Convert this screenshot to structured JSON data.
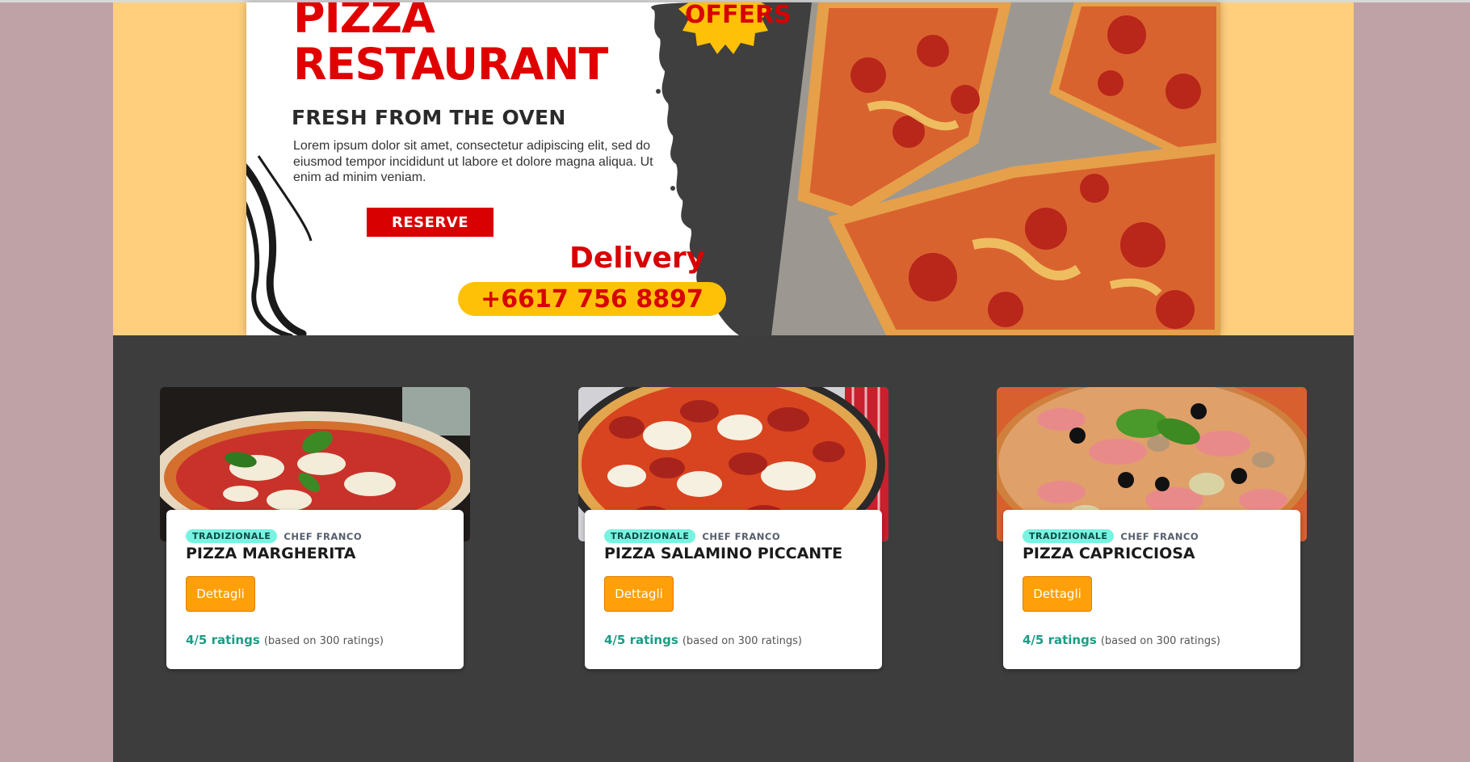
{
  "banner": {
    "title_line1": "PIZZA",
    "title_line2": "RESTAURANT",
    "subtitle": "FRESH FROM THE OVEN",
    "description": "Lorem ipsum dolor sit amet, consectetur adipiscing elit, sed do eiusmod tempor incididunt ut labore et dolore magna aliqua. Ut enim ad minim veniam.",
    "reserve_label": "RESERVE",
    "offers_label": "OFFERS",
    "delivery_label": "Delivery",
    "phone": "+6617 756 8897"
  },
  "colors": {
    "page_bg": "#bfa2a6",
    "hero_bg": "#ffcf7d",
    "menu_bg": "#3d3d3d",
    "brand_red": "#d80000",
    "accent_yellow": "#ffc107",
    "button_orange": "#ff9f0a",
    "badge_teal": "#76f3e1",
    "rating_teal": "#1c9c86"
  },
  "cards": [
    {
      "badge": "TRADIZIONALE",
      "chef": "CHEF FRANCO",
      "title": "PIZZA MARGHERITA",
      "button": "Dettagli",
      "rating": "4/5 ratings",
      "rating_note": "(based on 300 ratings)"
    },
    {
      "badge": "TRADIZIONALE",
      "chef": "CHEF FRANCO",
      "title": "PIZZA SALAMINO PICCANTE",
      "button": "Dettagli",
      "rating": "4/5 ratings",
      "rating_note": "(based on 300 ratings)"
    },
    {
      "badge": "TRADIZIONALE",
      "chef": "CHEF FRANCO",
      "title": "PIZZA CAPRICCIOSA",
      "button": "Dettagli",
      "rating": "4/5 ratings",
      "rating_note": "(based on 300 ratings)"
    }
  ]
}
